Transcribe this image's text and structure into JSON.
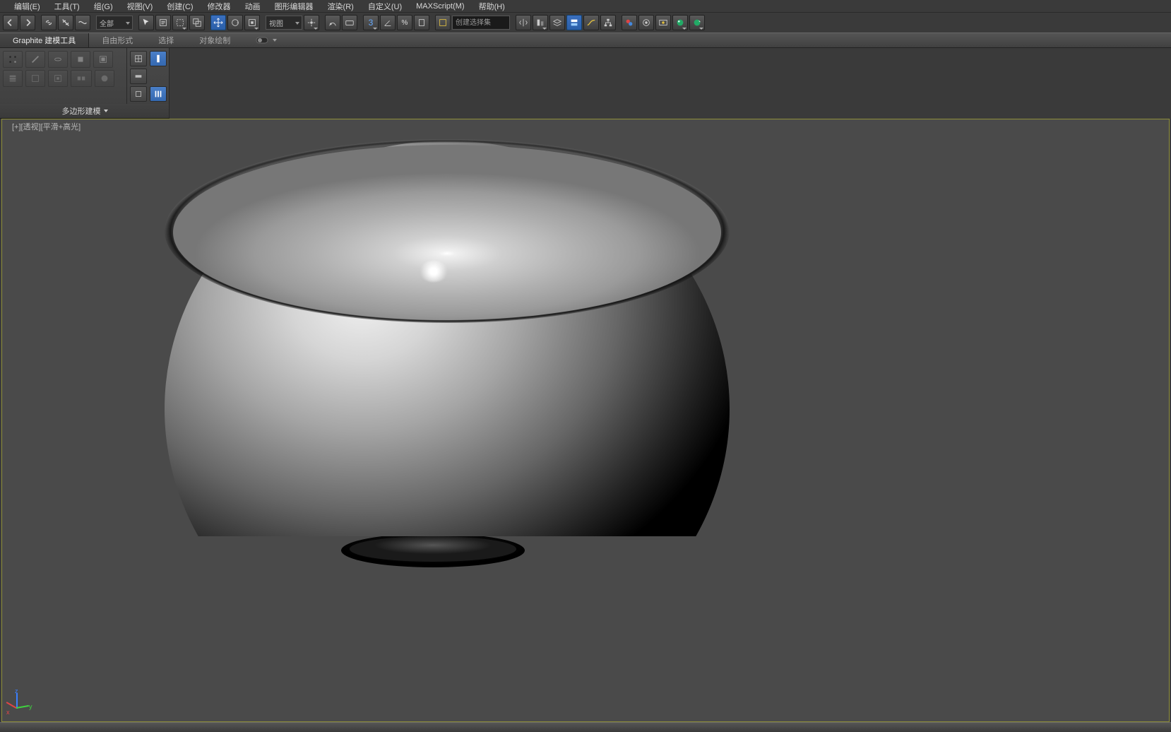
{
  "menu": {
    "items": [
      "编辑(E)",
      "工具(T)",
      "组(G)",
      "视图(V)",
      "创建(C)",
      "修改器",
      "动画",
      "图形编辑器",
      "渲染(R)",
      "自定义(U)",
      "MAXScript(M)",
      "帮助(H)"
    ]
  },
  "toolbar": {
    "selection_set_dropdown": "全部",
    "view_dropdown": "视图",
    "named_selection_placeholder": "创建选择集"
  },
  "ribbon": {
    "tabs": [
      "Graphite 建模工具",
      "自由形式",
      "选择",
      "对象绘制"
    ],
    "active_tab": 0,
    "panel_title": "多边形建模"
  },
  "viewport": {
    "label": "[+][透视][平滑+高光]"
  },
  "gizmo": {
    "x": "x",
    "y": "y",
    "z": "z"
  }
}
